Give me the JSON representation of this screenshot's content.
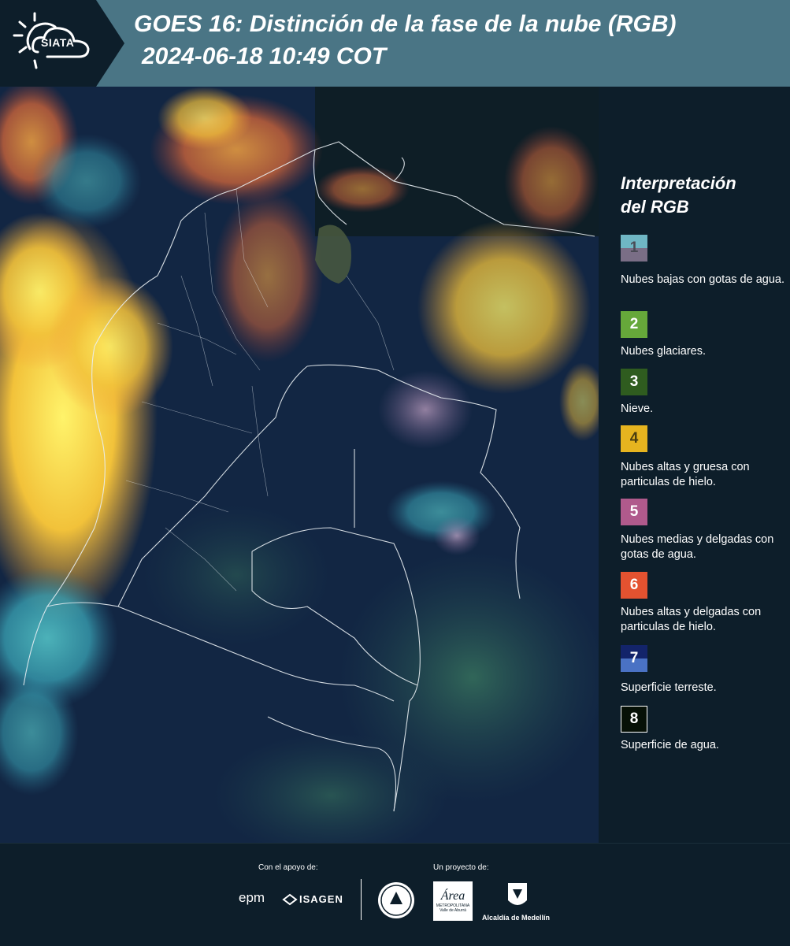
{
  "header": {
    "logo_text": "SIATA",
    "title_line1": "GOES 16: Distinción de la fase de la nube (RGB)",
    "title_line2": "2024-06-18 10:49 COT"
  },
  "legend": {
    "title_line1": "Interpretación",
    "title_line2": "del RGB",
    "items": [
      {
        "number": "1",
        "label": "Nubes bajas con gotas de agua.",
        "color_top": "#6fb6c4",
        "color_bottom": "#7a6e86",
        "text_color": "#4a4a55"
      },
      {
        "number": "2",
        "label": "Nubes glaciares.",
        "color_top": "#66a83a",
        "color_bottom": "#66a83a",
        "text_color": "#ffffff"
      },
      {
        "number": "3",
        "label": "Nieve.",
        "color_top": "#2f5c1f",
        "color_bottom": "#2f5c1f",
        "text_color": "#ffffff"
      },
      {
        "number": "4",
        "label": "Nubes altas y gruesa con particulas de hielo.",
        "color_top": "#e6b41f",
        "color_bottom": "#e6b41f",
        "text_color": "#4a3d10"
      },
      {
        "number": "5",
        "label": "Nubes medias y delgadas con gotas de agua.",
        "color_top": "#b05a8c",
        "color_bottom": "#b05a8c",
        "text_color": "#ffffff"
      },
      {
        "number": "6",
        "label": "Nubes altas y delgadas con particulas de hielo.",
        "color_top": "#e45230",
        "color_bottom": "#e45230",
        "text_color": "#ffffff"
      },
      {
        "number": "7",
        "label": "Superficie terreste.",
        "color_top": "#13246a",
        "color_bottom": "#4a72c4",
        "text_color": "#ffffff"
      },
      {
        "number": "8",
        "label": "Superficie de agua.",
        "color_top": "#061006",
        "color_bottom": "#061006",
        "text_color": "#ffffff"
      }
    ]
  },
  "footer": {
    "support_label": "Con el apoyo de:",
    "project_label": "Un proyecto de:",
    "epm": "epm",
    "isagen": "ISAGEN",
    "area_metro": "Área",
    "area_metro_sub": "METROPOLITANA",
    "area_metro_sub2": "Valle de Aburrá",
    "alcaldia": "Alcaldía de Medellín"
  },
  "colors": {
    "header_bg": "#4a7585",
    "panel_bg": "#0d1e2a"
  }
}
